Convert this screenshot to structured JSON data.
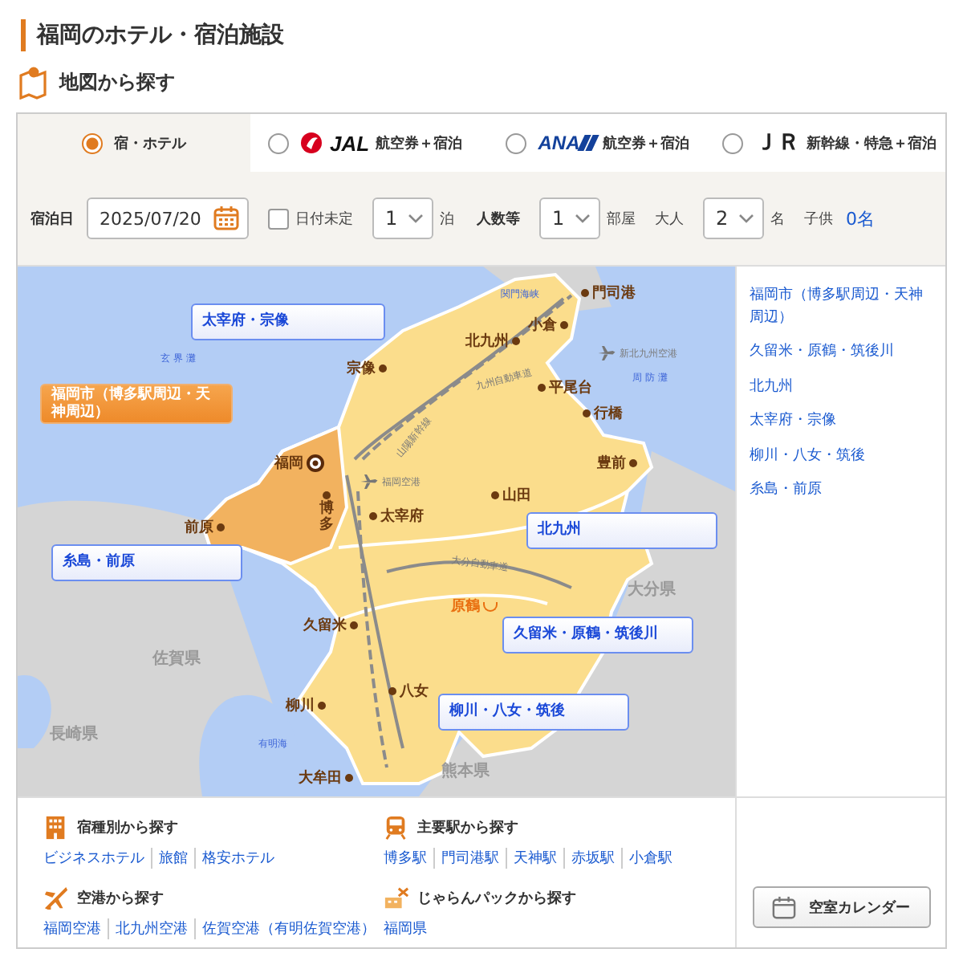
{
  "page_title": "福岡のホテル・宿泊施設",
  "section_title": "地図から探す",
  "tabs": [
    {
      "kind": "plain",
      "label": "宿・ホテル",
      "selected": true
    },
    {
      "kind": "jal",
      "logo": "JAL",
      "label": "航空券＋宿泊",
      "selected": false
    },
    {
      "kind": "ana",
      "logo": "ANA",
      "label": "航空券＋宿泊",
      "selected": false
    },
    {
      "kind": "jr",
      "logo": "ＪＲ",
      "label": "新幹線・特急＋宿泊",
      "selected": false
    }
  ],
  "search_form": {
    "date_label": "宿泊日",
    "date": "2025/07/20",
    "date_undecided": {
      "label": "日付未定",
      "checked": false
    },
    "nights": {
      "value": "1",
      "unit": "泊"
    },
    "guests_label": "人数等",
    "rooms": {
      "value": "1",
      "unit": "部屋"
    },
    "adults": {
      "label": "大人",
      "value": "2",
      "unit": "名"
    },
    "children": {
      "label": "子供",
      "value": "0名"
    }
  },
  "map": {
    "regions": [
      {
        "label": "太宰府・宗像",
        "selected": false
      },
      {
        "label": "福岡市（博多駅周辺・天神周辺）",
        "selected": true
      },
      {
        "label": "北九州",
        "selected": false
      },
      {
        "label": "糸島・前原",
        "selected": false
      },
      {
        "label": "久留米・原鶴・筑後川",
        "selected": false
      },
      {
        "label": "柳川・八女・筑後",
        "selected": false
      }
    ],
    "places": [
      {
        "kind": "city",
        "text": "門司港"
      },
      {
        "kind": "city",
        "text": "小倉"
      },
      {
        "kind": "city",
        "text": "北九州"
      },
      {
        "kind": "city",
        "text": "宗像"
      },
      {
        "kind": "city",
        "text": "平尾台"
      },
      {
        "kind": "city",
        "text": "行橋"
      },
      {
        "kind": "capital",
        "text": "福岡"
      },
      {
        "kind": "city",
        "text": "豊前"
      },
      {
        "kind": "city",
        "text": "山田"
      },
      {
        "kind": "city",
        "text": "前原"
      },
      {
        "kind": "city",
        "text": "博多"
      },
      {
        "kind": "city",
        "text": "太宰府"
      },
      {
        "kind": "city",
        "text": "久留米"
      },
      {
        "kind": "spa",
        "text": "原鶴"
      },
      {
        "kind": "city",
        "text": "八女"
      },
      {
        "kind": "city",
        "text": "柳川"
      },
      {
        "kind": "city",
        "text": "大牟田"
      },
      {
        "kind": "prefecture",
        "text": "大分県"
      },
      {
        "kind": "prefecture",
        "text": "佐賀県"
      },
      {
        "kind": "prefecture",
        "text": "長崎県"
      },
      {
        "kind": "prefecture",
        "text": "熊本県"
      },
      {
        "kind": "sea",
        "text": "玄 界 灘"
      },
      {
        "kind": "sea",
        "text": "周 防 灘"
      },
      {
        "kind": "sea",
        "text": "有明海"
      },
      {
        "kind": "sea",
        "text": "関門海峡"
      },
      {
        "kind": "airport",
        "text": "福岡空港"
      },
      {
        "kind": "airport",
        "text": "新北九州空港"
      },
      {
        "kind": "road",
        "text": "山陽新幹線"
      },
      {
        "kind": "road",
        "text": "九州自動車道"
      },
      {
        "kind": "road",
        "text": "大分自動車道"
      }
    ]
  },
  "area_list": [
    "福岡市（博多駅周辺・天神周辺）",
    "久留米・原鶴・筑後川",
    "北九州",
    "太宰府・宗像",
    "柳川・八女・筑後",
    "糸島・前原"
  ],
  "browse": [
    {
      "kind": "lodging",
      "heading": "宿種別から探す",
      "links": [
        "ビジネスホテル",
        "旅館",
        "格安ホテル"
      ]
    },
    {
      "kind": "station",
      "heading": "主要駅から探す",
      "links": [
        "博多駅",
        "門司港駅",
        "天神駅",
        "赤坂駅",
        "小倉駅"
      ]
    },
    {
      "kind": "airport",
      "heading": "空港から探す",
      "links": [
        "福岡空港",
        "北九州空港",
        "佐賀空港（有明佐賀空港）"
      ]
    },
    {
      "kind": "package",
      "heading": "じゃらんパックから探す",
      "links": [
        "福岡県"
      ]
    }
  ],
  "calendar_button": "空室カレンダー"
}
